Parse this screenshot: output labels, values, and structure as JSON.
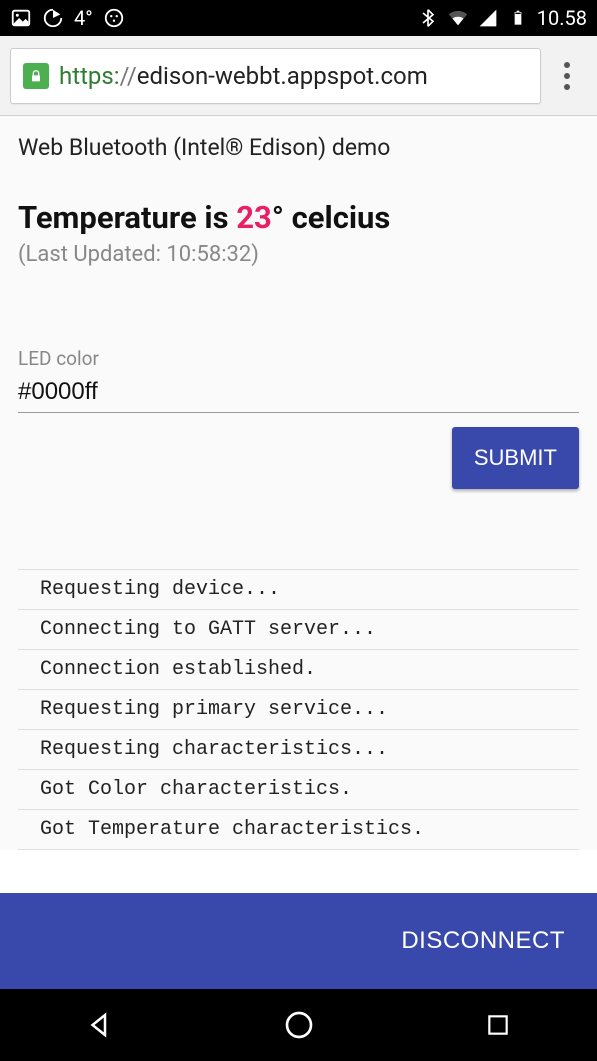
{
  "status_bar": {
    "temperature": "4°",
    "clock": "10.58"
  },
  "omnibox": {
    "scheme": "https:",
    "sep": "//",
    "host": "edison-webbt.appspot.com"
  },
  "page": {
    "demo_title": "Web Bluetooth (Intel® Edison) demo",
    "temp_prefix": "Temperature is ",
    "temp_value": "23",
    "temp_suffix": "° celcius",
    "updated_prefix": "(Last Updated: ",
    "updated_time": "10:58:32",
    "updated_suffix": ")",
    "field_label": "LED color",
    "field_value": "#0000ff",
    "submit_label": "SUBMIT",
    "disconnect_label": "DISCONNECT"
  },
  "log": [
    "Requesting device...",
    "Connecting to GATT server...",
    "Connection established.",
    "Requesting primary service...",
    "Requesting characteristics...",
    "Got Color characteristics.",
    "Got Temperature characteristics."
  ]
}
